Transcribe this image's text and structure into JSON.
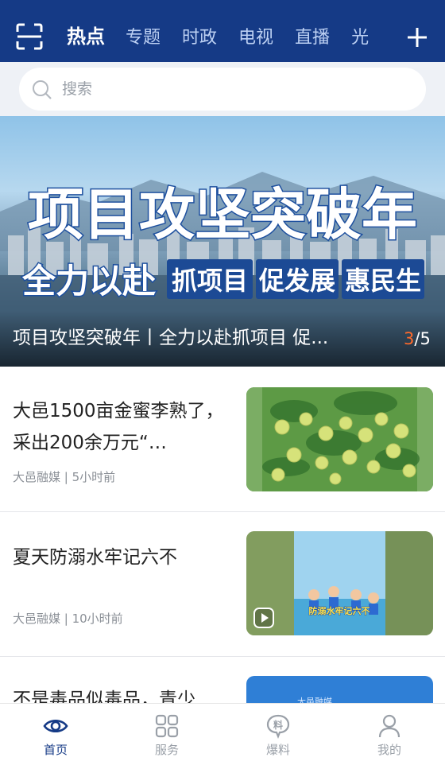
{
  "header": {
    "tabs": [
      "热点",
      "专题",
      "时政",
      "电视",
      "直播",
      "光"
    ],
    "active_tab_index": 0,
    "left_icon": "scan-icon",
    "right_icon": "plus-icon"
  },
  "search": {
    "placeholder": "搜索"
  },
  "banner": {
    "headline": "项目攻坚突破年",
    "slogan": "全力以赴",
    "tags": [
      "抓项目",
      "促发展",
      "惠民生"
    ],
    "caption": "项目攻坚突破年丨全力以赴抓项目  促...",
    "page_current": "3",
    "page_total": "/5"
  },
  "news": [
    {
      "title": "大邑1500亩金蜜李熟了，采出200余万元“…",
      "meta": "大邑融媒 | 5小时前"
    },
    {
      "title": "夏天防溺水牢记六不",
      "meta": "大邑融媒 | 10小时前",
      "thumb_text": "防溺水牢记六不"
    },
    {
      "title": "不是毒品似毒品，青少",
      "thumb_text": "大邑融媒"
    }
  ],
  "bottom_nav": [
    {
      "label": "首页",
      "icon": "eye-icon"
    },
    {
      "label": "服务",
      "icon": "grid-icon"
    },
    {
      "label": "爆料",
      "icon": "tip-off-icon",
      "icon_text": "料"
    },
    {
      "label": "我的",
      "icon": "user-icon"
    }
  ],
  "colors": {
    "primary": "#153a86",
    "tab_inactive": "#bcd0f3",
    "accent": "#ff6a2b"
  }
}
